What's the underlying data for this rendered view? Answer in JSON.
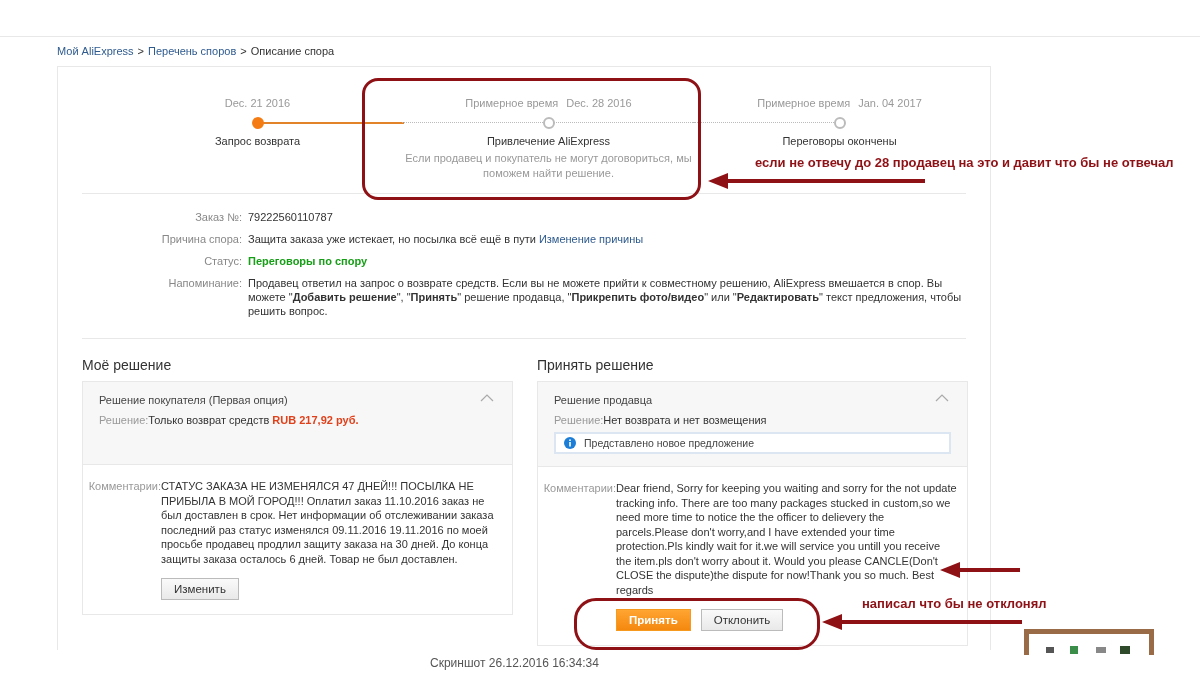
{
  "breadcrumb": [
    {
      "label": "Мой AliExpress",
      "kind": "link"
    },
    {
      "label": ">",
      "kind": "text"
    },
    {
      "label": "Перечень споров",
      "kind": "link"
    },
    {
      "label": ">",
      "kind": "text"
    },
    {
      "label": "Описание спора",
      "kind": "text"
    }
  ],
  "timeline": [
    {
      "date": "Dec. 21 2016",
      "title": "Запрос возврата",
      "completed": true
    },
    {
      "caption": "Примерное время",
      "date": "Dec. 28 2016",
      "title": "Привлечение AliExpress",
      "note": "Если продавец и покупатель не могут договориться, мы поможем найти решение.",
      "completed": false
    },
    {
      "caption": "Примерное время",
      "date": "Jan. 04 2017",
      "title": "Переговоры окончены",
      "completed": false
    }
  ],
  "info": [
    {
      "label": "Заказ №:",
      "value": "79222560110787",
      "kind": "plain"
    },
    {
      "label": "Причина спора:",
      "value": "Защита заказа уже истекает, но посылка всё ещё в пути",
      "link": "Изменение причины",
      "kind": "link"
    },
    {
      "label": "Статус:",
      "value": "Переговоры по спору",
      "kind": "status"
    },
    {
      "label": "Напоминание:",
      "value": "Продавец ответил на запрос о возврате средств. Если вы не можете прийти к совместному решению, AliExpress вмешается в спор. Вы можете \"**Добавить решение**\", \"**Принять**\" решение продавца, \"**Прикрепить фото/видео**\" или \"**Редактировать**\" текст предложения, чтобы решить вопрос.",
      "kind": "plain"
    }
  ],
  "my_solution": {
    "title": "Моё решение",
    "panel_title": "Решение покупателя (Первая опция)",
    "solution_label": "Решение:",
    "solution": "Только возврат средств",
    "amount": "RUB 217,92 руб.",
    "expanded": true,
    "comment_label": "Комментарии:",
    "comment": "СТАТУС ЗАКАЗА НЕ ИЗМЕНЯЛСЯ 47 ДНЕЙ!!! ПОСЫЛКА НЕ ПРИБЫЛА В МОЙ ГОРОД!!! Оплатил заказ 11.10.2016 заказ не был доставлен в срок. Нет информации об отслеживании заказа последний раз статус изменялся 09.11.2016 19.11.2016 по моей просьбе продавец продлил защиту заказа на 30 дней. До конца защиты заказа осталось 6 дней. Товар не был доставлен.",
    "buttons": [
      {
        "label": "Изменить",
        "kind": "secondary"
      }
    ]
  },
  "accept_solution": {
    "title": "Принять решение",
    "panel_title": "Решение продавца",
    "solution_label": "Решение:",
    "solution": "Нет возврата и нет возмещения",
    "notice": "Представлено новое предложение",
    "expanded": true,
    "comment_label": "Комментарии:",
    "comment": "Dear friend, Sorry for keeping you waiting and sorry for the not update tracking info. There are too many packages stucked in custom,so we need more time to notice the the officer to delievery the parcels.Please don't worry,and I have extended your time protection.Pls kindly wait for it.we will service you untill you receive the item.pls don't worry about it. Would you please CANCLE(Don't CLOSE the dispute)the dispute for now!Thank you so much. Best regards",
    "buttons": [
      {
        "label": "Принять",
        "kind": "primary"
      },
      {
        "label": "Отклонить",
        "kind": "secondary"
      }
    ]
  },
  "caption": "Скриншот 26.12.2016 16:34:34",
  "annotations": [
    {
      "text": "если не отвечу до 28 продавец на это и давит что бы не отвечал"
    },
    {
      "text": "написал что бы не отклонял"
    }
  ]
}
